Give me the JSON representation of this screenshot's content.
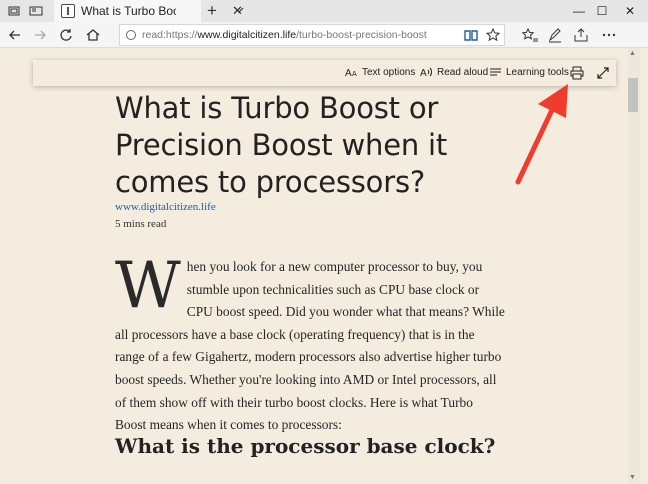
{
  "tab": {
    "title": "What is Turbo Boost or",
    "close": "✕"
  },
  "window": {
    "minimize": "—",
    "maximize": "☐",
    "close": "✕"
  },
  "tabbar": {
    "new_tab": "+"
  },
  "address": {
    "prefix": "read:https://",
    "domain": "www.digitalcitizen.life",
    "path": "/turbo-boost-precision-boost"
  },
  "reading_toolbar": {
    "text_options": "Text options",
    "read_aloud": "Read aloud",
    "learning_tools": "Learning tools"
  },
  "article": {
    "title": "What is Turbo Boost or Precision Boost when it comes to processors?",
    "source": "www.digitalcitizen.life",
    "read_time": "5 mins read",
    "drop_cap": "W",
    "intro": "hen you look for a new computer processor to buy, you stumble upon technicalities such as CPU base clock or CPU boost speed. Did you wonder what that means? While all processors have a base clock (operating frequency) that is in the range of a few Gigahertz, modern processors also advertise higher turbo boost speeds. Whether you're looking into AMD or Intel processors, all of them show off with their turbo boost clocks. Here is what Turbo Boost means when it comes to processors:",
    "subheading": "What is the processor base clock?"
  },
  "colors": {
    "annotation_arrow": "#f03c2e",
    "page_bg": "#f4ecdf",
    "link": "#1f5fa8"
  }
}
